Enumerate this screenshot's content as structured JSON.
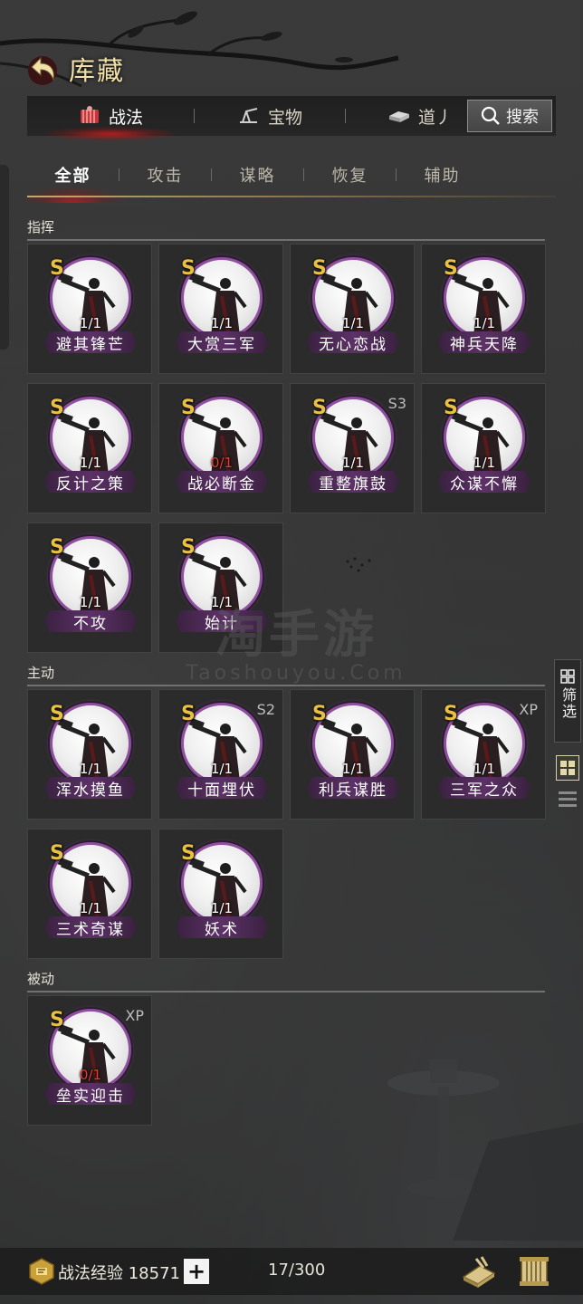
{
  "header": {
    "title": "库藏"
  },
  "top_tabs": [
    {
      "label": "战法",
      "icon": "strategy-icon"
    },
    {
      "label": "宝物",
      "icon": "treasure-icon"
    },
    {
      "label": "道丿",
      "icon": "item-icon"
    }
  ],
  "search": {
    "label": "搜索"
  },
  "sub_tabs": [
    "全部",
    "攻击",
    "谋略",
    "恢复",
    "辅助"
  ],
  "sections": [
    {
      "title": "指挥",
      "cards": [
        {
          "grade": "S",
          "tag": "",
          "count": "1/1",
          "name": "避其锋芒"
        },
        {
          "grade": "S",
          "tag": "",
          "count": "1/1",
          "name": "大赏三军"
        },
        {
          "grade": "S",
          "tag": "",
          "count": "1/1",
          "name": "无心恋战"
        },
        {
          "grade": "S",
          "tag": "",
          "count": "1/1",
          "name": "神兵天降"
        },
        {
          "grade": "S",
          "tag": "",
          "count": "1/1",
          "name": "反计之策"
        },
        {
          "grade": "S",
          "tag": "",
          "count": "0/1",
          "name": "战必断金"
        },
        {
          "grade": "S",
          "tag": "S3",
          "count": "1/1",
          "name": "重整旗鼓"
        },
        {
          "grade": "S",
          "tag": "",
          "count": "1/1",
          "name": "众谋不懈"
        },
        {
          "grade": "S",
          "tag": "",
          "count": "1/1",
          "name": "不攻"
        },
        {
          "grade": "S",
          "tag": "",
          "count": "1/1",
          "name": "始计"
        }
      ]
    },
    {
      "title": "主动",
      "cards": [
        {
          "grade": "S",
          "tag": "",
          "count": "1/1",
          "name": "浑水摸鱼"
        },
        {
          "grade": "S",
          "tag": "S2",
          "count": "1/1",
          "name": "十面埋伏"
        },
        {
          "grade": "S",
          "tag": "",
          "count": "1/1",
          "name": "利兵谋胜"
        },
        {
          "grade": "S",
          "tag": "XP",
          "count": "1/1",
          "name": "三军之众"
        },
        {
          "grade": "S",
          "tag": "",
          "count": "1/1",
          "name": "三术奇谋"
        },
        {
          "grade": "S",
          "tag": "",
          "count": "1/1",
          "name": "妖术"
        }
      ]
    },
    {
      "title": "被动",
      "cards": [
        {
          "grade": "S",
          "tag": "XP",
          "count": "0/1",
          "name": "垒实迎击"
        }
      ]
    }
  ],
  "watermark": {
    "main": "淘手游",
    "sub": "Taoshouyou.Com"
  },
  "filter": {
    "label": "筛选"
  },
  "bottom": {
    "exp_label": "战法经验 18571",
    "plus": "+",
    "capacity": "17/300"
  },
  "colors": {
    "accent_gold": "#e9c042",
    "count_red": "#e53e32",
    "frame_purple": "#8e4f9f"
  }
}
